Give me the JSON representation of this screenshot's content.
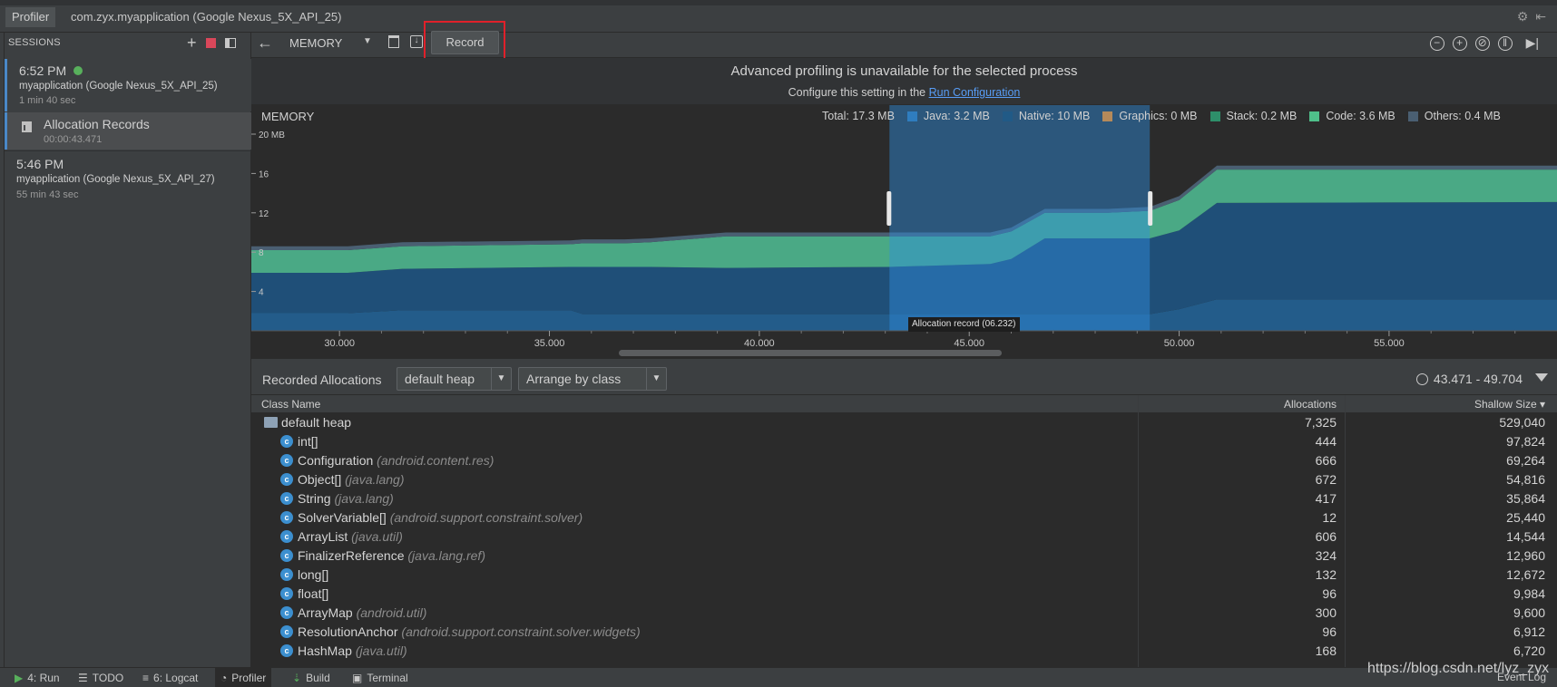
{
  "window": {
    "tab_profiler": "Profiler",
    "tab_device": "com.zyx.myapplication (Google Nexus_5X_API_25)"
  },
  "sessions": {
    "header": "SESSIONS",
    "items": [
      {
        "time": "6:52 PM",
        "app": "myapplication (Google Nexus_5X_API_25)",
        "duration": "1 min 40 sec",
        "live": true
      },
      {
        "time": "5:46 PM",
        "app": "myapplication (Google Nexus_5X_API_27)",
        "duration": "55 min 43 sec",
        "live": false
      }
    ],
    "artifact": {
      "title": "Allocation Records",
      "subtitle": "00:00:43.471"
    }
  },
  "toolbar": {
    "profiler_select": "MEMORY",
    "record_label": "Record"
  },
  "banner": {
    "title": "Advanced profiling is unavailable for the selected process",
    "subtitle_prefix": "Configure this setting in the",
    "subtitle_link": "Run Configuration"
  },
  "memory_chart": {
    "label": "MEMORY",
    "y_axis_unit": "20 MB",
    "total": "Total: 17.3 MB",
    "legend": [
      {
        "label": "Java: 3.2 MB",
        "color": "#2f7dbf"
      },
      {
        "label": "Native: 10 MB",
        "color": "#215a86"
      },
      {
        "label": "Graphics: 0 MB",
        "color": "#b58a5a"
      },
      {
        "label": "Stack: 0.2 MB",
        "color": "#2e8f6a"
      },
      {
        "label": "Code: 3.6 MB",
        "color": "#4fbf8a"
      },
      {
        "label": "Others: 0.4 MB",
        "color": "#4a5f72"
      }
    ],
    "selection_tooltip": "Allocation record (06.232)"
  },
  "chart_data": {
    "type": "area",
    "title": "MEMORY",
    "ylabel": "MB",
    "ylim": [
      0,
      20
    ],
    "y_ticks": [
      "20 MB",
      "16",
      "12",
      "8",
      "4"
    ],
    "x_ticks": [
      "30.000",
      "35.000",
      "40.000",
      "45.000",
      "50.000",
      "55.000"
    ],
    "xlim": [
      27.9,
      59.0
    ],
    "selection": [
      43.1,
      49.3
    ],
    "x": [
      27.9,
      30.2,
      31.5,
      35.5,
      35.8,
      36.8,
      37.4,
      39.2,
      43.1,
      45.5,
      46.0,
      46.8,
      48.3,
      49.3,
      50.0,
      50.9,
      59.0
    ],
    "series": [
      {
        "name": "Native",
        "color": "#235c8a",
        "values": [
          1.8,
          1.8,
          2.1,
          2.1,
          1.7,
          1.7,
          1.7,
          1.7,
          1.7,
          1.7,
          1.7,
          1.7,
          1.7,
          1.7,
          2.2,
          3.2,
          3.2
        ]
      },
      {
        "name": "Java",
        "color": "#1f4f78",
        "values": [
          4.1,
          4.1,
          4.2,
          4.4,
          4.8,
          4.8,
          4.8,
          4.7,
          4.8,
          5.1,
          5.6,
          7.7,
          7.7,
          7.7,
          8.0,
          9.8,
          9.9
        ]
      },
      {
        "name": "Code",
        "color": "#4aa985",
        "values": [
          2.3,
          2.3,
          2.3,
          2.3,
          2.4,
          2.4,
          2.5,
          3.2,
          3.1,
          2.8,
          2.8,
          2.6,
          2.6,
          2.8,
          3.1,
          3.4,
          3.3
        ]
      },
      {
        "name": "Others",
        "color": "#4a5f72",
        "values": [
          0.4,
          0.4,
          0.4,
          0.4,
          0.4,
          0.4,
          0.4,
          0.4,
          0.4,
          0.4,
          0.4,
          0.4,
          0.4,
          0.4,
          0.4,
          0.4,
          0.4
        ]
      }
    ]
  },
  "allocations": {
    "title": "Recorded Allocations",
    "heap_select": "default heap",
    "arrange_select": "Arrange by class",
    "range": "43.471 - 49.704",
    "columns": {
      "name": "Class Name",
      "allocations": "Allocations",
      "shallow": "Shallow Size ▾"
    },
    "root": {
      "name": "default heap",
      "allocations": "7,325",
      "shallow": "529,040"
    },
    "rows": [
      {
        "name": "int[]",
        "pkg": "",
        "allocations": "444",
        "shallow": "97,824"
      },
      {
        "name": "Configuration",
        "pkg": "(android.content.res)",
        "allocations": "666",
        "shallow": "69,264"
      },
      {
        "name": "Object[]",
        "pkg": "(java.lang)",
        "allocations": "672",
        "shallow": "54,816"
      },
      {
        "name": "String",
        "pkg": "(java.lang)",
        "allocations": "417",
        "shallow": "35,864"
      },
      {
        "name": "SolverVariable[]",
        "pkg": "(android.support.constraint.solver)",
        "allocations": "12",
        "shallow": "25,440"
      },
      {
        "name": "ArrayList",
        "pkg": "(java.util)",
        "allocations": "606",
        "shallow": "14,544"
      },
      {
        "name": "FinalizerReference",
        "pkg": "(java.lang.ref)",
        "allocations": "324",
        "shallow": "12,960"
      },
      {
        "name": "long[]",
        "pkg": "",
        "allocations": "132",
        "shallow": "12,672"
      },
      {
        "name": "float[]",
        "pkg": "",
        "allocations": "96",
        "shallow": "9,984"
      },
      {
        "name": "ArrayMap",
        "pkg": "(android.util)",
        "allocations": "300",
        "shallow": "9,600"
      },
      {
        "name": "ResolutionAnchor",
        "pkg": "(android.support.constraint.solver.widgets)",
        "allocations": "96",
        "shallow": "6,912"
      },
      {
        "name": "HashMap",
        "pkg": "(java.util)",
        "allocations": "168",
        "shallow": "6,720"
      }
    ]
  },
  "bottom_bar": {
    "run": "4: Run",
    "todo": "TODO",
    "logcat": "6: Logcat",
    "profiler": "Profiler",
    "build": "Build",
    "terminal": "Terminal",
    "event_log": "Event Log"
  },
  "watermark": "https://blog.csdn.net/lyz_zyx"
}
